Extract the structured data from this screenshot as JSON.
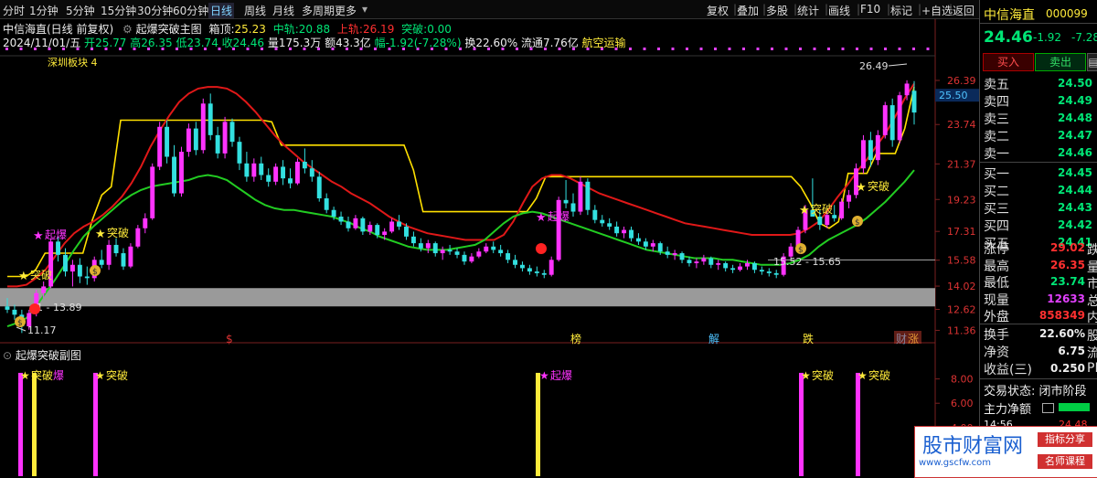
{
  "toolbar": {
    "periods": [
      "分时",
      "1分钟",
      "5分钟",
      "15分钟",
      "30分钟",
      "60分钟",
      "日线",
      "周线",
      "月线",
      "多周期",
      "更多"
    ],
    "active": "日线",
    "right_buttons": [
      "复权",
      "叠加",
      "多股",
      "统计",
      "画线",
      "F10",
      "标记",
      "+自选",
      "返回"
    ]
  },
  "header": {
    "stock_name": "中信海直(日线 前复权)",
    "indicator_name": "起爆突破主图",
    "box_top_label": "箱顶:",
    "box_top": "25.23",
    "mid_label": "中轨:",
    "mid": "20.88",
    "upper_label": "上轨:",
    "upper": "26.19",
    "breakout_label": "突破:",
    "breakout": "0.00"
  },
  "ohlc_line": {
    "date": "2024/11/01/五",
    "open_label": "开",
    "open": "25.77",
    "high_label": "高",
    "high": "26.35",
    "low_label": "低",
    "low": "23.74",
    "close_label": "收",
    "close": "24.46",
    "volume_label": "量",
    "volume": "175.3万",
    "amount_label": "额",
    "amount": "43.3亿",
    "change_label": "幅",
    "change": "-1.92(-7.28%)",
    "turnover_label": "换",
    "turnover": "22.60%",
    "float_label": "流通",
    "float": "7.76亿",
    "sector": "航空运输"
  },
  "board_label": "深圳板块 4",
  "sub_title": "起爆突破副图",
  "chart_data": {
    "type": "candlestick",
    "y_ticks": [
      "26.39",
      "23.74",
      "21.37",
      "19.23",
      "17.31",
      "15.58",
      "14.02",
      "12.62",
      "11.36"
    ],
    "y_range": [
      11.0,
      27.6
    ],
    "current_price_label": "25.50",
    "sub_y_ticks": [
      "8.00",
      "6.00",
      "4.00",
      "2.00"
    ],
    "sub_y_range": [
      0,
      10
    ],
    "annotations": {
      "max_label": "26.49",
      "mid_range_label": "15.52 - 15.65",
      "low_range_label": "1 - 13.89",
      "min_label": "11.17",
      "signal_breakout": "突破",
      "signal_explode": "起爆",
      "signal_explode_partial": "爆"
    },
    "bottom_tags": [
      "$",
      "榜",
      "解",
      "跌",
      "财",
      "涨"
    ],
    "candles": [
      [
        12.8,
        13.3,
        12.4,
        12.6
      ],
      [
        12.6,
        12.9,
        12.0,
        12.3
      ],
      [
        12.3,
        12.6,
        11.2,
        11.6
      ],
      [
        11.6,
        12.6,
        11.4,
        12.4
      ],
      [
        12.4,
        13.8,
        12.2,
        13.6
      ],
      [
        13.6,
        14.3,
        13.3,
        14.0
      ],
      [
        14.0,
        16.9,
        13.9,
        16.7
      ],
      [
        16.7,
        17.0,
        15.5,
        15.9
      ],
      [
        15.9,
        16.3,
        14.6,
        14.9
      ],
      [
        14.9,
        15.6,
        14.0,
        15.3
      ],
      [
        15.3,
        15.7,
        14.2,
        14.6
      ],
      [
        14.6,
        15.2,
        14.1,
        14.5
      ],
      [
        14.5,
        15.8,
        14.3,
        15.6
      ],
      [
        15.6,
        16.2,
        15.1,
        15.3
      ],
      [
        15.3,
        16.8,
        15.0,
        16.5
      ],
      [
        16.5,
        16.9,
        15.8,
        16.0
      ],
      [
        16.0,
        16.3,
        15.0,
        15.2
      ],
      [
        15.2,
        16.6,
        15.1,
        16.4
      ],
      [
        16.4,
        17.7,
        16.3,
        17.5
      ],
      [
        17.5,
        18.4,
        17.2,
        18.1
      ],
      [
        18.1,
        21.4,
        18.0,
        21.2
      ],
      [
        21.2,
        23.9,
        21.0,
        23.6
      ],
      [
        23.6,
        24.0,
        21.4,
        21.8
      ],
      [
        21.8,
        22.5,
        19.4,
        19.6
      ],
      [
        19.6,
        22.4,
        19.4,
        22.1
      ],
      [
        22.1,
        23.8,
        21.8,
        23.5
      ],
      [
        23.5,
        23.9,
        21.9,
        22.2
      ],
      [
        22.2,
        25.3,
        22.0,
        25.0
      ],
      [
        25.0,
        25.6,
        22.8,
        23.1
      ],
      [
        23.1,
        23.6,
        21.7,
        22.0
      ],
      [
        22.0,
        24.2,
        21.7,
        23.9
      ],
      [
        23.9,
        24.1,
        22.4,
        22.7
      ],
      [
        22.7,
        23.0,
        21.0,
        21.4
      ],
      [
        21.4,
        22.1,
        20.3,
        20.6
      ],
      [
        20.6,
        21.7,
        20.3,
        21.4
      ],
      [
        21.4,
        21.8,
        20.4,
        20.7
      ],
      [
        20.7,
        21.1,
        20.0,
        20.3
      ],
      [
        20.3,
        21.4,
        20.1,
        21.2
      ],
      [
        21.2,
        21.6,
        20.1,
        20.5
      ],
      [
        20.5,
        21.1,
        19.9,
        20.2
      ],
      [
        20.2,
        21.7,
        20.1,
        21.5
      ],
      [
        21.5,
        22.3,
        20.8,
        21.1
      ],
      [
        21.1,
        21.6,
        20.3,
        20.6
      ],
      [
        20.6,
        20.9,
        19.1,
        19.3
      ],
      [
        19.3,
        19.6,
        18.4,
        18.6
      ],
      [
        18.6,
        18.8,
        18.0,
        18.2
      ],
      [
        18.2,
        18.5,
        17.7,
        17.9
      ],
      [
        17.9,
        18.2,
        17.3,
        17.5
      ],
      [
        17.5,
        18.3,
        17.4,
        18.1
      ],
      [
        18.1,
        18.2,
        17.1,
        17.3
      ],
      [
        17.3,
        17.9,
        17.1,
        17.7
      ],
      [
        17.7,
        17.8,
        16.9,
        17.1
      ],
      [
        17.1,
        17.5,
        16.8,
        17.3
      ],
      [
        17.3,
        18.1,
        17.2,
        17.9
      ],
      [
        17.9,
        18.3,
        17.4,
        17.6
      ],
      [
        17.6,
        17.8,
        16.8,
        17.0
      ],
      [
        17.0,
        17.3,
        16.4,
        16.6
      ],
      [
        16.6,
        16.9,
        16.1,
        16.3
      ],
      [
        16.3,
        16.8,
        16.0,
        16.6
      ],
      [
        16.6,
        16.7,
        15.8,
        16.0
      ],
      [
        16.0,
        16.4,
        15.6,
        16.2
      ],
      [
        16.2,
        16.5,
        15.9,
        16.1
      ],
      [
        16.1,
        16.3,
        15.7,
        15.9
      ],
      [
        15.9,
        16.1,
        15.3,
        15.5
      ],
      [
        15.5,
        16.0,
        15.4,
        15.8
      ],
      [
        15.8,
        16.3,
        15.7,
        16.1
      ],
      [
        16.1,
        16.6,
        16.0,
        16.4
      ],
      [
        16.4,
        16.7,
        16.0,
        16.2
      ],
      [
        16.2,
        16.5,
        15.8,
        16.0
      ],
      [
        16.0,
        16.2,
        15.4,
        15.6
      ],
      [
        15.6,
        15.9,
        15.1,
        15.3
      ],
      [
        15.3,
        15.5,
        14.9,
        15.1
      ],
      [
        15.1,
        15.3,
        14.7,
        14.9
      ],
      [
        14.9,
        15.2,
        14.6,
        14.8
      ],
      [
        14.8,
        15.0,
        14.5,
        14.7
      ],
      [
        14.7,
        15.8,
        14.6,
        15.6
      ],
      [
        15.6,
        19.4,
        15.5,
        19.2
      ],
      [
        19.2,
        20.4,
        18.7,
        19.0
      ],
      [
        19.0,
        19.6,
        18.2,
        18.5
      ],
      [
        18.5,
        20.6,
        18.3,
        20.3
      ],
      [
        20.3,
        20.5,
        18.3,
        18.6
      ],
      [
        18.6,
        18.9,
        17.8,
        18.0
      ],
      [
        18.0,
        18.3,
        17.6,
        17.8
      ],
      [
        17.8,
        18.1,
        17.4,
        17.6
      ],
      [
        17.6,
        17.9,
        17.0,
        17.2
      ],
      [
        17.2,
        17.6,
        16.9,
        17.4
      ],
      [
        17.4,
        17.6,
        16.7,
        16.9
      ],
      [
        16.9,
        17.2,
        16.5,
        16.7
      ],
      [
        16.7,
        16.9,
        16.2,
        16.4
      ],
      [
        16.4,
        16.8,
        16.1,
        16.6
      ],
      [
        16.6,
        16.7,
        15.9,
        16.1
      ],
      [
        16.1,
        16.4,
        15.7,
        15.9
      ],
      [
        15.9,
        16.2,
        15.6,
        16.0
      ],
      [
        16.0,
        16.1,
        15.4,
        15.6
      ],
      [
        15.6,
        15.8,
        15.2,
        15.4
      ],
      [
        15.4,
        15.7,
        15.1,
        15.5
      ],
      [
        15.5,
        15.9,
        15.3,
        15.7
      ],
      [
        15.7,
        15.8,
        15.1,
        15.3
      ],
      [
        15.3,
        15.6,
        15.0,
        15.4
      ],
      [
        15.4,
        15.5,
        14.9,
        15.1
      ],
      [
        15.1,
        15.3,
        14.8,
        15.0
      ],
      [
        15.0,
        15.4,
        14.9,
        15.2
      ],
      [
        15.2,
        15.6,
        15.0,
        15.4
      ],
      [
        15.4,
        15.5,
        14.8,
        15.0
      ],
      [
        15.0,
        15.2,
        14.7,
        14.9
      ],
      [
        14.9,
        15.1,
        14.6,
        14.8
      ],
      [
        14.8,
        15.0,
        14.5,
        14.7
      ],
      [
        14.7,
        16.0,
        14.6,
        15.8
      ],
      [
        15.8,
        16.6,
        15.7,
        16.4
      ],
      [
        16.4,
        17.6,
        16.3,
        17.4
      ],
      [
        17.4,
        18.9,
        17.2,
        18.6
      ],
      [
        18.6,
        20.5,
        18.3,
        18.2
      ],
      [
        18.2,
        18.6,
        17.4,
        17.7
      ],
      [
        17.7,
        18.5,
        17.5,
        18.3
      ],
      [
        18.3,
        18.9,
        17.9,
        18.1
      ],
      [
        18.1,
        19.3,
        18.0,
        19.1
      ],
      [
        19.1,
        19.8,
        18.7,
        19.5
      ],
      [
        19.5,
        21.4,
        19.3,
        21.1
      ],
      [
        21.1,
        23.1,
        20.8,
        22.8
      ],
      [
        22.8,
        23.3,
        21.2,
        21.6
      ],
      [
        21.6,
        23.4,
        21.3,
        23.1
      ],
      [
        23.1,
        25.1,
        22.9,
        24.9
      ],
      [
        24.9,
        25.3,
        22.4,
        22.8
      ],
      [
        22.8,
        25.7,
        22.6,
        25.5
      ],
      [
        25.5,
        26.4,
        25.2,
        26.2
      ],
      [
        25.77,
        26.35,
        23.74,
        24.46
      ]
    ],
    "upper_line": [
      14.0,
      14.0,
      14.1,
      14.5,
      15.0,
      15.8,
      16.6,
      17.2,
      17.6,
      17.9,
      18.3,
      18.8,
      19.4,
      20.2,
      21.2,
      22.4,
      23.4,
      24.3,
      25.1,
      25.6,
      25.9,
      26.0,
      26.0,
      25.9,
      25.6,
      25.1,
      24.5,
      23.8,
      23.1,
      22.5,
      22.0,
      21.5,
      21.1,
      20.7,
      20.3,
      20.0,
      19.6,
      19.3,
      19.0,
      18.6,
      18.2,
      17.9,
      17.6,
      17.4,
      17.2,
      17.1,
      17.0,
      16.9,
      16.8,
      16.8,
      16.8,
      16.8,
      17.1,
      17.9,
      19.0,
      20.0,
      20.5,
      20.7,
      20.7,
      20.5,
      20.2,
      19.9,
      19.6,
      19.4,
      19.2,
      19.0,
      18.8,
      18.6,
      18.4,
      18.2,
      18.0,
      17.8,
      17.7,
      17.6,
      17.5,
      17.4,
      17.3,
      17.2,
      17.1,
      17.1,
      17.1,
      17.1,
      17.1,
      17.2,
      17.5,
      17.9,
      18.6,
      19.4,
      20.1,
      20.9,
      21.6,
      22.4,
      23.2,
      24.2,
      25.3,
      26.2
    ],
    "middle_line": [
      14.6,
      14.6,
      14.6,
      15.0,
      16.0,
      16.0,
      16.0,
      16.0,
      16.0,
      18.0,
      19.5,
      20.0,
      24.0,
      24.0,
      24.0,
      24.0,
      24.0,
      24.0,
      24.0,
      24.0,
      24.0,
      24.0,
      24.0,
      24.0,
      24.0,
      24.0,
      24.0,
      24.0,
      23.9,
      22.5,
      22.5,
      22.5,
      22.5,
      22.5,
      22.5,
      22.5,
      22.5,
      22.5,
      22.5,
      22.5,
      22.5,
      22.5,
      22.5,
      21.0,
      18.5,
      18.5,
      18.5,
      18.5,
      18.5,
      18.5,
      18.5,
      18.5,
      18.5,
      18.5,
      18.5,
      18.5,
      19.3,
      20.6,
      20.6,
      20.6,
      20.6,
      20.6,
      20.6,
      20.6,
      20.6,
      20.6,
      20.6,
      20.6,
      20.6,
      20.6,
      20.6,
      20.6,
      20.6,
      20.6,
      20.6,
      20.6,
      20.6,
      20.6,
      20.6,
      20.6,
      20.6,
      20.6,
      20.6,
      20.6,
      20.0,
      19.0,
      17.8,
      17.5,
      17.9,
      20.8,
      20.8,
      20.8,
      22.0,
      22.0,
      22.0,
      23.5,
      26.0
    ],
    "lower_line": [
      11.6,
      11.8,
      12.1,
      12.8,
      13.6,
      14.4,
      15.3,
      16.2,
      17.0,
      17.6,
      18.1,
      18.6,
      19.1,
      19.5,
      19.8,
      20.0,
      20.1,
      20.2,
      20.3,
      20.4,
      20.6,
      20.7,
      20.6,
      20.4,
      20.0,
      19.6,
      19.2,
      18.9,
      18.7,
      18.6,
      18.6,
      18.5,
      18.4,
      18.3,
      18.2,
      18.0,
      17.8,
      17.5,
      17.3,
      17.0,
      16.8,
      16.6,
      16.4,
      16.3,
      16.2,
      16.2,
      16.2,
      16.3,
      16.4,
      16.5,
      16.8,
      17.3,
      17.8,
      18.2,
      18.4,
      18.5,
      18.4,
      18.2,
      18.0,
      17.8,
      17.6,
      17.4,
      17.2,
      17.0,
      16.8,
      16.6,
      16.4,
      16.2,
      16.1,
      16.0,
      15.9,
      15.8,
      15.7,
      15.7,
      15.7,
      15.6,
      15.6,
      15.5,
      15.4,
      15.3,
      15.3,
      15.3,
      15.4,
      15.6,
      15.9,
      16.4,
      16.8,
      17.1,
      17.4,
      17.7,
      18.1,
      18.6,
      19.1,
      19.7,
      20.3,
      21.0
    ]
  },
  "right_panel": {
    "name": "中信海直",
    "code": "000099",
    "price": "24.46",
    "change": "-1.92",
    "change_pct": "-7.28",
    "buy_label": "买入",
    "sell_label": "卖出",
    "asks": [
      [
        "卖五",
        "24.50"
      ],
      [
        "卖四",
        "24.49"
      ],
      [
        "卖三",
        "24.48"
      ],
      [
        "卖二",
        "24.47"
      ],
      [
        "卖一",
        "24.46"
      ]
    ],
    "bids": [
      [
        "买一",
        "24.45"
      ],
      [
        "买二",
        "24.44"
      ],
      [
        "买三",
        "24.43"
      ],
      [
        "买四",
        "24.42"
      ],
      [
        "买五",
        "24.41"
      ]
    ],
    "stats": [
      [
        "涨停",
        "29.02",
        "跌"
      ],
      [
        "最高",
        "26.35",
        "量"
      ],
      [
        "最低",
        "23.74",
        "市"
      ],
      [
        "现量",
        "12633",
        "总"
      ],
      [
        "外盘",
        "858349",
        "内"
      ]
    ],
    "stats2": [
      [
        "换手",
        "22.60%",
        "股"
      ],
      [
        "净资",
        "6.75",
        "流"
      ],
      [
        "收益(三)",
        "0.250",
        "PE"
      ]
    ],
    "trade_status": "交易状态: 闭市阶段",
    "main_net": "主力净额",
    "time_partial": "14:56",
    "price_partial": "24.48"
  },
  "watermark": {
    "brand": "股市财富网",
    "tag1": "指标分享",
    "url": "www.gscfw.com",
    "tag2": "名师课程"
  }
}
